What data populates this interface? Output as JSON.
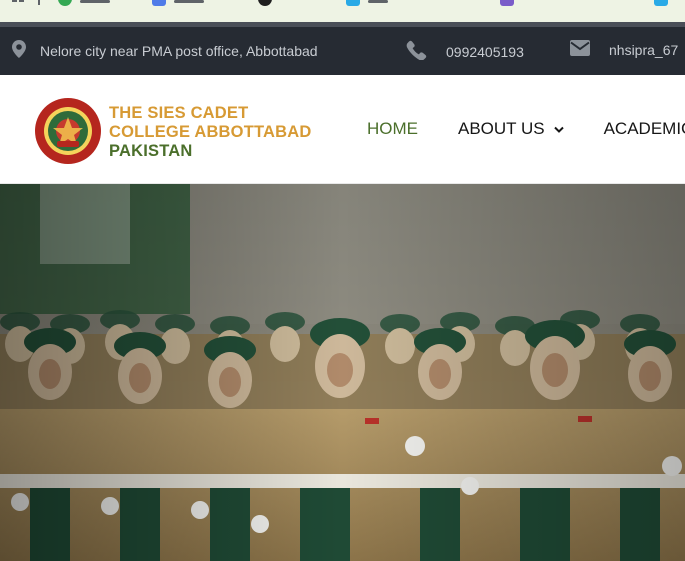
{
  "colors": {
    "topbar_bg": "#262b33",
    "topbar_text": "#c8ccd2",
    "brand_gold": "#d79a34",
    "brand_green": "#4b6f2b",
    "cadet_uniform": "#a48c5e",
    "beret_green": "#23513a"
  },
  "bookmarks": {
    "icons": [
      "apps-grid-icon",
      "bookmark-green-icon",
      "bookmark-blue-icon",
      "bookmark-dark-icon",
      "bookmark-cyan-icon",
      "bookmark-purple-icon",
      "bookmark-cyan-icon"
    ]
  },
  "topbar": {
    "address_icon": "map-marker-icon",
    "address": "Nelore city near PMA post office, Abbottabad",
    "phone_icon": "phone-icon",
    "phone": "0992405193",
    "email_icon": "envelope-icon",
    "email": "nhsipra_67"
  },
  "header": {
    "logo_icon": "college-crest-icon",
    "logo_line1": "THE SIES CADET",
    "logo_line2": "COLLEGE ABBOTTABAD",
    "logo_line3": "PAKISTAN",
    "nav": [
      {
        "label": "HOME",
        "active": true
      },
      {
        "label": "ABOUT US",
        "dropdown": true
      },
      {
        "label": "ACADEMICS"
      }
    ]
  },
  "hero": {
    "image": "female cadets marching parade photo",
    "icon": "parade-photo"
  }
}
